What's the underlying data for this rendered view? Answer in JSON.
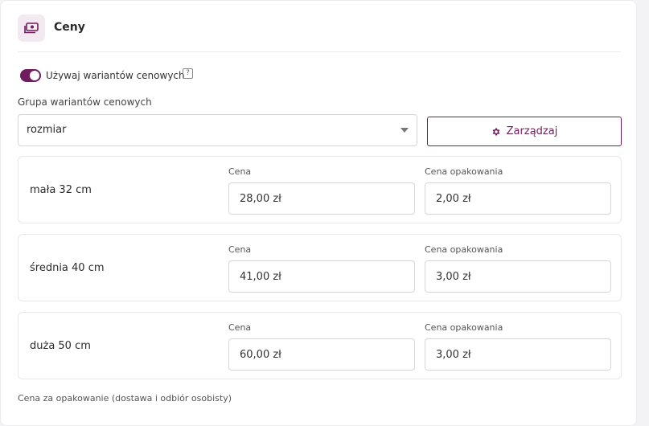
{
  "section": {
    "title": "Ceny",
    "icon": "money-icon"
  },
  "toggle": {
    "label": "Używaj wariantów cenowych",
    "enabled": true,
    "help": "?"
  },
  "group": {
    "label": "Grupa wariantów cenowych",
    "selected": "rozmiar",
    "manage_label": "Zarządzaj"
  },
  "variants": [
    {
      "name": "mała 32 cm",
      "price_label": "Cena",
      "price": "28,00 zł",
      "package_label": "Cena opakowania",
      "package": "2,00 zł"
    },
    {
      "name": "średnia 40 cm",
      "price_label": "Cena",
      "price": "41,00 zł",
      "package_label": "Cena opakowania",
      "package": "3,00 zł"
    },
    {
      "name": "duża 50 cm",
      "price_label": "Cena",
      "price": "60,00 zł",
      "package_label": "Cena opakowania",
      "package": "3,00 zł"
    }
  ],
  "footer": {
    "note": "Cena za opakowanie (dostawa i odbiór osobisty)"
  },
  "colors": {
    "accent": "#6f1d5e",
    "icon_bg": "#f3e9f1"
  }
}
